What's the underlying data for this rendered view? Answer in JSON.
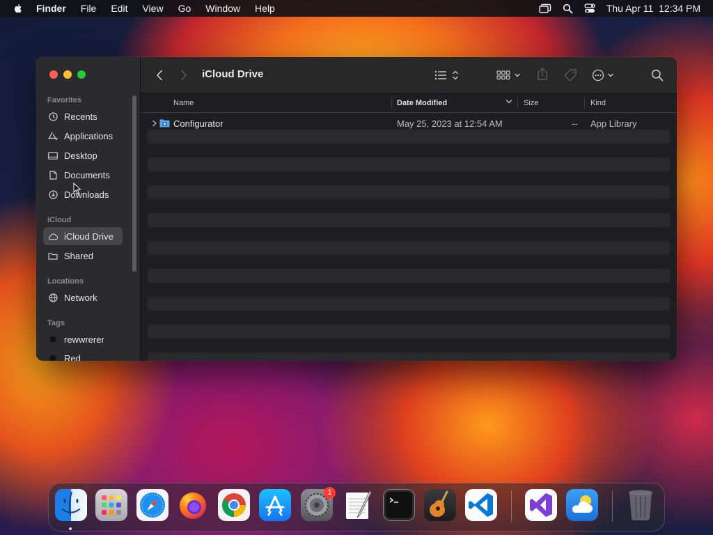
{
  "menubar": {
    "app_name": "Finder",
    "items": [
      "File",
      "Edit",
      "View",
      "Go",
      "Window",
      "Help"
    ],
    "datetime": "Thu Apr 11  12:34 PM"
  },
  "window": {
    "title": "iCloud Drive",
    "sidebar": {
      "sections": [
        {
          "heading": "Favorites",
          "items": [
            "Recents",
            "Applications",
            "Desktop",
            "Documents",
            "Downloads"
          ]
        },
        {
          "heading": "iCloud",
          "items": [
            "iCloud Drive",
            "Shared"
          ]
        },
        {
          "heading": "Locations",
          "items": [
            "Network"
          ]
        },
        {
          "heading": "Tags",
          "items": [
            "rewwrerer",
            "Red"
          ]
        }
      ],
      "selected": "iCloud Drive"
    },
    "columns": [
      "Name",
      "Date Modified",
      "Size",
      "Kind"
    ],
    "files": [
      {
        "name": "Configurator",
        "date_modified": "May 25, 2023 at 12:54 AM",
        "size": "--",
        "kind": "App Library"
      }
    ]
  },
  "dock": {
    "apps": [
      "Finder",
      "Launchpad",
      "Safari",
      "Firefox",
      "Chrome",
      "App Store",
      "System Settings",
      "TextEdit",
      "Terminal",
      "GarageBand",
      "Visual Studio Code",
      "Visual Studio",
      "Weather",
      "Trash"
    ],
    "system_settings_badge": "1"
  },
  "colors": {
    "window_bg": "#1f1f21",
    "sidebar_bg": "#2b2b2e",
    "close": "#ff5f57",
    "minimize": "#febc2e",
    "zoom": "#28c840",
    "selection": "#464649"
  }
}
